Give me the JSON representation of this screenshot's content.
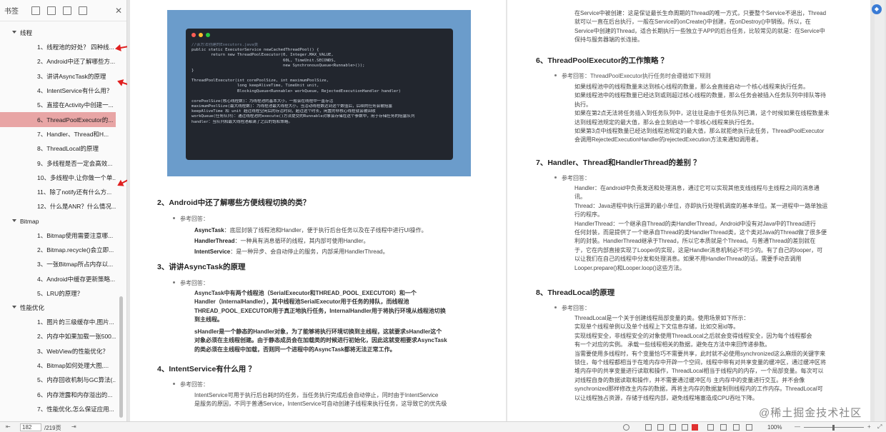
{
  "sidebar": {
    "title": "书签",
    "close": "✕",
    "groups": [
      {
        "label": "线程",
        "items": [
          "1、线程池的好处？ 四种线...",
          "2、Android中还了解哪些方...",
          "3、讲讲AsyncTask的原理",
          "4、IntentService有什么用？",
          "5、直接在Activity中创建一...",
          "6、ThreadPoolExecutor的...",
          "7、Handler、Thread和H...",
          "8、ThreadLocal的原理",
          "9、多线程是否一定会高效...",
          "10、多线程中,让你做一个单...",
          "11、除了notify还有什么方...",
          "12、什么是ANR？什么情况..."
        ]
      },
      {
        "label": "Bitmap",
        "items": [
          "1、Bitmap使用需要注意哪...",
          "2、Bitmap.recycle()会立即...",
          "3、一张Bitmap所占内存以...",
          "4、Android中缓存更新策略...",
          "5、LRU的原理？"
        ]
      },
      {
        "label": "性能优化",
        "items": [
          "1、图片的三级缓存中,图片...",
          "2、内存中如果加载一张500...",
          "3、WebView的性能优化？",
          "4、Bitmap如何处理大图,...",
          "5、内存回收机制与GC算法(...",
          "6、内存泄露和内存溢出的...",
          "7、性能优化,怎么保证应用..."
        ]
      }
    ]
  },
  "code": {
    "comment": "//该方法创建的Executors.java类",
    "lines1": [
      "public static ExecutorService newCachedThreadPool() {",
      "        return new ThreadPoolExecutor(0, Integer.MAX_VALUE,",
      "                                      60L, TimeUnit.SECONDS,",
      "                                      new SynchronousQueue<Runnable>());",
      "}"
    ],
    "lines2": [
      "ThreadPoolExecutor(int corePoolSize, int maximumPoolSize,",
      "                   long keepAliveTime, TimeUnit unit,",
      "                   BlockingQueue<Runnable> workQueue, RejectedExecutionHandler handler)"
    ],
    "lines3": [
      "corePoolSize(核心线程数)：为线程池的基本大小，一般会在线程中一直存活",
      "maximumPoolSize(最大线程数)：为线程池最大线程大小，当活动线程数达到这个数值后，后续的任务会被阻塞",
      "keepAliveTime 和 unit 超过线程空闲后的存活时间，超过这个时长，闲置的非核心线程就会被回收",
      "workQueue(任务队列)：通过线程池的execute()方法提交的Runnable对象会存储在这个参数中，用于存储任务的阻塞队列",
      "handler：当队列和最大线程池都满了之后的饱和策略。"
    ]
  },
  "left": {
    "h2": "2、Android中还了解哪些方便线程切换的类？",
    "h2_ans": "参考回答：",
    "h2_lines": [
      {
        "b": "AsyncTask",
        "t": "：底层封装了线程池和Handler，便于执行后台任务以及在子线程中进行UI操作。"
      },
      {
        "b": "HandlerThread",
        "t": "：一种具有消息循环的线程，其内部可使用Handler。"
      },
      {
        "b": "IntentService",
        "t": "：是一种异步、会自动停止的服务，内部采用HandlerThread。"
      }
    ],
    "h3": "3、讲讲AsyncTask的原理",
    "h3_ans": "参考回答：",
    "h3_p1": [
      "AsyncTask中有两个线程池（SerialExecutor和THREAD_POOL_EXECUTOR）和一个",
      "Handler（InternalHandler），其中线程池SerialExecutor用于任务的排队，而线程池",
      "THREAD_POOL_EXECUTOR用于真正地执行任务，InternalHandler用于将执行环境从线程池切换",
      "到主线程。"
    ],
    "h3_p2": [
      "sHandler是一个静态的Handler对象，为了能够将执行环境切换到主线程，这就要求sHandler这个",
      "对象必须在主线程创建。由于静态成员会在加载类的时候进行初始化，因此这就变相要求AsyncTask",
      "的类必须在主线程中加载，否则同一个进程中的AsyncTask都将无法正常工作。"
    ],
    "h4": "4、IntentService有什么用 ？",
    "h4_ans": "参考回答：",
    "h4_p": [
      "IntentService可用于执行后台耗时的任务，当任务执行完成后会自动停止，同时由于IntentService",
      "是服务的原因，不同于普通Service，IntentService可自动创建子线程来执行任务，这导致它的优先级"
    ]
  },
  "right": {
    "top_p": [
      "在Service中被创建：这是保证最长生命周期的Thread的唯一方式，只要整个Service不退出，Thread",
      "就可以一直在后台执行，一般在Service的onCreate()中创建，在onDestroy()中销毁。所以，在",
      "Service中创建的Thread，适合长期执行一些独立于APP的后台任务，比较常见的就是：在Service中",
      "保持与服务器端的长连接。"
    ],
    "h6": "6、ThreadPoolExecutor的工作策略 ？",
    "h6_ans": "参考回答：ThreadPoolExecutor执行任务时会遵循如下规则",
    "h6_p": [
      "如果线程池中的线程数量未达到核心线程的数量，那么会直接启动一个核心线程来执行任务。",
      "如果线程池中的线程数量已经达到或则超过核心线程的数量，那么任务会被插入任务队列中排队等待",
      "执行。",
      "如果在第2点无法将任务插入到任务队列中，这往往是由于任务队列已满，这个时候如果在线程数量未",
      "达到线程池规定的最大值，那么会立刻启动一个非核心线程来执行任务。",
      "如果第3点中线程数量已经达到线程池规定的最大值，那么就拒绝执行此任务，ThreadPoolExecutor",
      "会调用RejectedExecutionHandler的rejectedExecution方法来通知调用者。"
    ],
    "h7": "7、Handler、Thread和HandlerThread的差别 ？",
    "h7_ans": "参考回答：",
    "h7_p": [
      "Handler：在android中负责发送和处理消息，通过它可以实现其他支线线程与主线程之间的消息通",
      "讯。",
      "Thread：Java进程中执行运算的最小单位，亦即执行处理机调度的基本单位。某一进程中一路单独运",
      "行的程序。",
      "HandlerThread：一个继承自Thread的类HandlerThread，Android中没有对Java中的Thread进行",
      "任何封装，而是提供了一个继承自Thread的类HandlerThread类，这个类对Java的Thread做了很多便",
      "利的封装。HandlerThread继承于Thread，所以它本质就是个Thread。与普通Thread的差别就在",
      "于，它在内部直接实现了Looper的实现，这是Handler消息机制必不可少的。有了自己的looper，可",
      "以让我们在自己的线程中分发和处理消息。如果不用HandlerThread的话，需要手动去调用",
      "Looper.prepare()和Looper.loop()这些方法。"
    ],
    "h8": "8、ThreadLocal的原理",
    "h8_ans": "参考回答：",
    "h8_p": [
      "ThreadLocal是一个关于创建线程局部变量的类。使用场景如下所示：",
      "实现单个线程单例以及单个线程上下文信息存储，比如交易id等。",
      "实现线程安全，非线程安全的对象使用ThreadLocal之后就会变得线程安全，因为每个线程都会",
      "有一个对应的实例。 承载一些线程相关的数据，避免在方法中来回传递参数。",
      "当需要使用多线程时，有个变量恰巧不需要共享，此时就不必使用synchronized这么麻烦的关键字来",
      "锁住，每个线程都相当于在堆内存中开辟一个空间，线程中带有对共享变量的缓冲区，通过缓冲区将",
      "堆内存中的共享变量进行读取和操作，ThreadLocal相当于线程内的内存，一个局部变量。每次可以",
      "对线程自身的数据读取和操作，并不需要通过缓冲区与 主内存中的变量进行交互。并不会像",
      "synchronized那样修改主内存的数据，再将主内存的数据复制到线程内的工作内存。ThreadLocal可",
      "以让线程独占资源，存储于线程内部，避免线程堵塞造成CPU吞吐下降。"
    ]
  },
  "statusbar": {
    "page_current": "182",
    "page_total": "/219页",
    "zoom": "100%",
    "zoom_minus": "—",
    "zoom_plus": "+"
  },
  "watermark": "@稀土掘金技术社区",
  "colors": {
    "accent_active": "#e8a5a5",
    "arrow": "#e02020",
    "figure_bg": "#6b9ccb"
  }
}
